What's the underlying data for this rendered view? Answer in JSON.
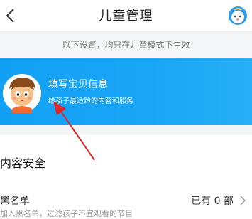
{
  "header": {
    "title": "儿童管理",
    "back_icon": "chevron-left-icon",
    "avatar_icon": "baby-avatar-icon"
  },
  "notice": {
    "text": "以下设置，均只在儿童模式下生效"
  },
  "banner": {
    "title": "填写宝贝信息",
    "subtitle": "给孩子最适龄的内容和服务",
    "icon": "child-face-icon",
    "background": "#18a3f5"
  },
  "content_safety": {
    "title": "内容安全",
    "blacklist": {
      "label": "黑名单",
      "sub": "加入黑名单，过滤孩子不宜观看的节目",
      "value": "已有 0 部"
    }
  },
  "annotation": {
    "color": "#e02424"
  }
}
